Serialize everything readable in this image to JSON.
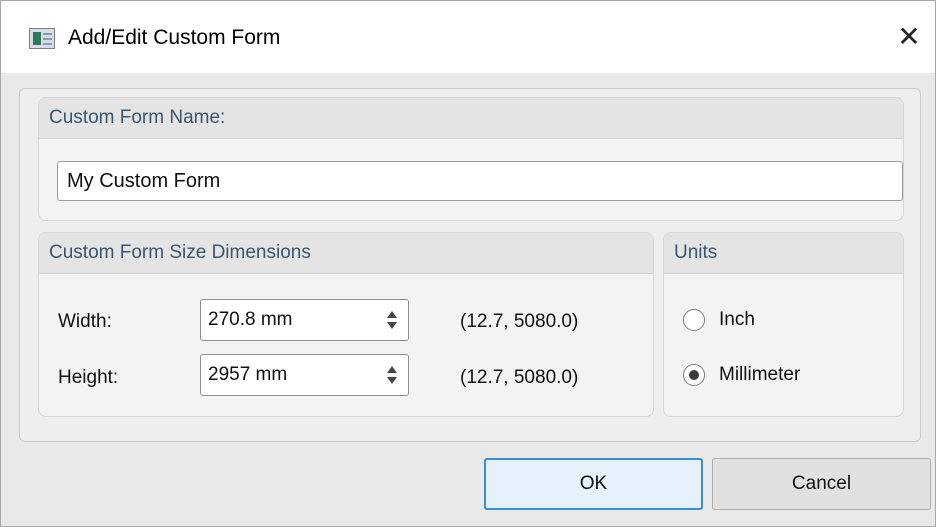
{
  "window": {
    "title": "Add/Edit Custom Form",
    "close_glyph": "✕"
  },
  "name_group": {
    "header": "Custom Form Name:",
    "input_value": "My Custom Form"
  },
  "dims_group": {
    "header": "Custom Form Size Dimensions",
    "width": {
      "label": "Width:",
      "value": "270.8 mm",
      "range": "(12.7, 5080.0)"
    },
    "height": {
      "label": "Height:",
      "value": "2957 mm",
      "range": "(12.7, 5080.0)"
    }
  },
  "units_group": {
    "header": "Units",
    "options": [
      {
        "label": "Inch",
        "selected": false
      },
      {
        "label": "Millimeter",
        "selected": true
      }
    ]
  },
  "buttons": {
    "ok": "OK",
    "cancel": "Cancel"
  },
  "colors": {
    "group_header_text": "#3a5572",
    "default_button_border": "#3b8fd6"
  },
  "icons": {
    "app": "window-app-icon",
    "close": "close-icon",
    "spin": "spin-arrows-icon"
  }
}
